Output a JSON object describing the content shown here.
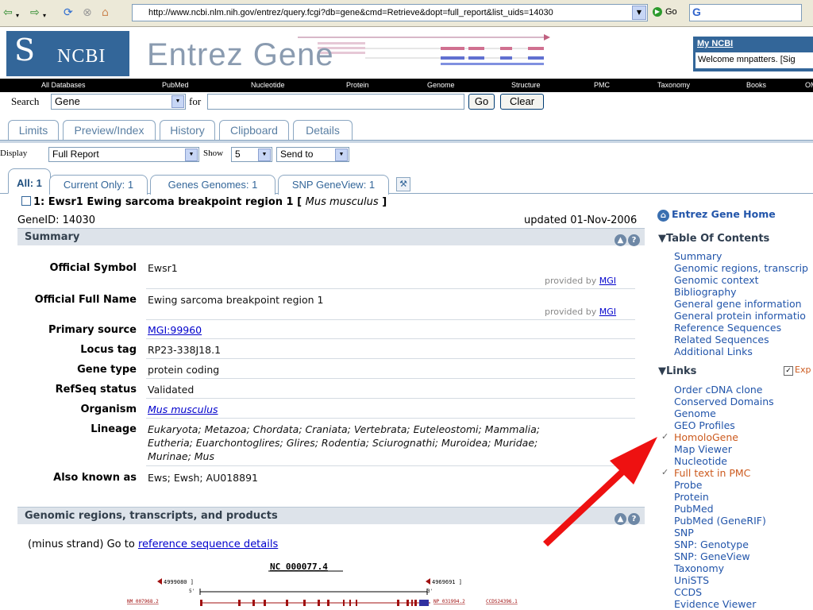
{
  "browser": {
    "url": "http://www.ncbi.nlm.nih.gov/entrez/query.fcgi?db=gene&cmd=Retrieve&dopt=full_report&list_uids=14030",
    "go_label": "Go",
    "google_glyph": "G"
  },
  "header": {
    "logo_text": "NCBI",
    "title": "Entrez Gene",
    "myncbi_title": "My NCBI",
    "myncbi_welcome": "Welcome mnpatters. [Sig"
  },
  "db_bar": [
    "All Databases",
    "PubMed",
    "Nucleotide",
    "Protein",
    "Genome",
    "Structure",
    "PMC",
    "Taxonomy",
    "Books",
    "OM"
  ],
  "search": {
    "label": "Search",
    "db": "Gene",
    "for_label": "for",
    "query": "",
    "go_label": "Go",
    "clear_label": "Clear"
  },
  "tabs": [
    "Limits",
    "Preview/Index",
    "History",
    "Clipboard",
    "Details"
  ],
  "display": {
    "label": "Display",
    "value": "Full Report",
    "show_label": "Show",
    "show_value": "5",
    "sendto_label": "Send to"
  },
  "result_tabs": [
    "All: 1",
    "Current Only: 1",
    "Genes Genomes: 1",
    "SNP GeneView: 1"
  ],
  "gene": {
    "heading_prefix": "1: Ewsr1 Ewing sarcoma breakpoint region 1 [",
    "organism_italic": "Mus musculus",
    "heading_suffix": "]",
    "gene_id": "GeneID: 14030",
    "updated": "updated 01-Nov-2006"
  },
  "summary": {
    "title": "Summary",
    "provided_by_label": "provided by",
    "provided_by_link": "MGI",
    "rows": [
      {
        "label": "Official Symbol",
        "value": "Ewsr1"
      },
      {
        "label": "Official Full Name",
        "value": "Ewing sarcoma breakpoint region 1"
      },
      {
        "label": "Primary source",
        "value": "MGI:99960"
      },
      {
        "label": "Locus tag",
        "value": "RP23-338J18.1"
      },
      {
        "label": "Gene type",
        "value": "protein coding"
      },
      {
        "label": "RefSeq status",
        "value": "Validated"
      },
      {
        "label": "Organism",
        "value": "Mus musculus"
      },
      {
        "label": "Lineage",
        "value_lines": [
          "Eukaryota; Metazoa; Chordata; Craniata; Vertebrata; Euteleostomi; Mammalia;",
          "Eutheria; Euarchontoglires; Glires; Rodentia; Sciurognathi; Muroidea; Muridae;",
          "Murinae; Mus"
        ]
      },
      {
        "label": "Also known as",
        "value": "Ews; Ewsh; AU018891"
      }
    ]
  },
  "genomic": {
    "title": "Genomic regions, transcripts, and products",
    "note_prefix": "(minus strand) Go to ",
    "note_link": "reference sequence details",
    "contig": "NC_000077.4",
    "left_coord": "4999080 ]",
    "right_coord": "4969691 ]",
    "five_prime": "5'",
    "three_prime": "3'",
    "left_acc": "NM_007968.2",
    "right_acc": "NP_031994.2",
    "ccds": "CCDS24396.1"
  },
  "sidebar": {
    "home": "Entrez Gene Home",
    "toc_title": "Table Of Contents",
    "toc": [
      "Summary",
      "Genomic regions, transcrip",
      "Genomic context",
      "Bibliography",
      "General gene information",
      "General protein informatio",
      "Reference Sequences",
      "Related Sequences",
      "Additional Links"
    ],
    "links_title": "Links",
    "links_expand": "Exp",
    "links": [
      {
        "label": "Order cDNA clone",
        "checked": false
      },
      {
        "label": "Conserved Domains",
        "checked": false
      },
      {
        "label": "Genome",
        "checked": false
      },
      {
        "label": "GEO Profiles",
        "checked": false
      },
      {
        "label": "HomoloGene",
        "checked": true
      },
      {
        "label": "Map Viewer",
        "checked": false
      },
      {
        "label": "Nucleotide",
        "checked": false
      },
      {
        "label": "Full text in PMC",
        "checked": true
      },
      {
        "label": "Probe",
        "checked": false
      },
      {
        "label": "Protein",
        "checked": false
      },
      {
        "label": "PubMed",
        "checked": false
      },
      {
        "label": "PubMed (GeneRIF)",
        "checked": false
      },
      {
        "label": "SNP",
        "checked": false
      },
      {
        "label": "SNP: Genotype",
        "checked": false
      },
      {
        "label": "SNP: GeneView",
        "checked": false
      },
      {
        "label": "Taxonomy",
        "checked": false
      },
      {
        "label": "UniSTS",
        "checked": false
      },
      {
        "label": "CCDS",
        "checked": false
      },
      {
        "label": "Evidence Viewer",
        "checked": false
      }
    ]
  },
  "colors": {
    "ncbi_blue": "#336699",
    "arrow": "#ee1111",
    "highlight_link": "#cc5a1e"
  }
}
